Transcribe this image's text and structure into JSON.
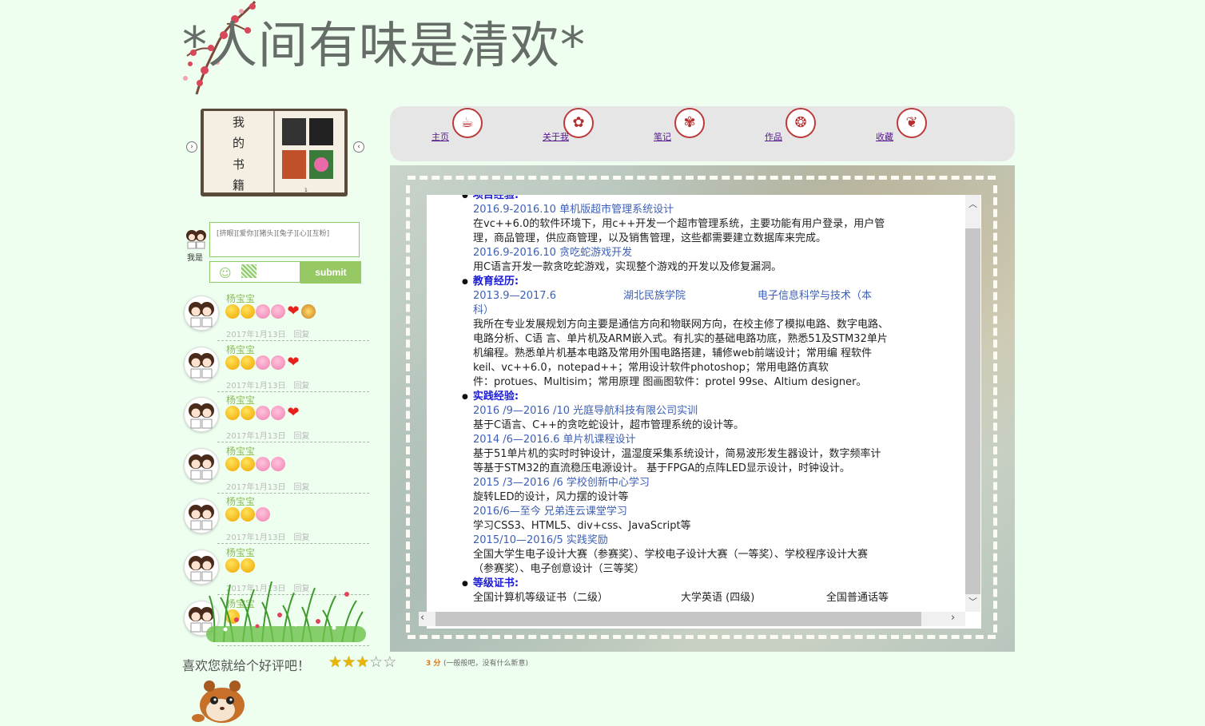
{
  "site": {
    "title": "*人间有味是清欢*"
  },
  "bookshelf": {
    "title_chars": [
      "我",
      "的",
      "书",
      "籍"
    ],
    "page_no": "1"
  },
  "comment_box": {
    "avatar_label": "我是",
    "placeholder": "[挤眼][爱你][猪头][兔子][心][互粉]",
    "submit_label": "submit"
  },
  "comments": [
    {
      "name": "杨宝宝",
      "date": "2017年1月13日",
      "reply": "回复",
      "emojis": [
        "face",
        "face",
        "pig",
        "pig",
        "heart",
        "mess"
      ]
    },
    {
      "name": "杨宝宝",
      "date": "2017年1月13日",
      "reply": "回复",
      "emojis": [
        "face",
        "face",
        "pig",
        "pig",
        "heart"
      ]
    },
    {
      "name": "杨宝宝",
      "date": "2017年1月13日",
      "reply": "回复",
      "emojis": [
        "face",
        "face",
        "pig",
        "pig",
        "heart"
      ]
    },
    {
      "name": "杨宝宝",
      "date": "2017年1月13日",
      "reply": "回复",
      "emojis": [
        "face",
        "face",
        "pig",
        "pig"
      ]
    },
    {
      "name": "杨宝宝",
      "date": "2017年1月13日",
      "reply": "回复",
      "emojis": [
        "face",
        "face",
        "pig"
      ]
    },
    {
      "name": "杨宝宝",
      "date": "2017年1月13日",
      "reply": "回复",
      "emojis": [
        "face",
        "face"
      ]
    },
    {
      "name": "杨宝宝",
      "date": "",
      "reply": "",
      "emojis": [
        "face"
      ]
    }
  ],
  "rating": {
    "label": "喜欢您就给个好评吧！",
    "value": 3,
    "max": 5,
    "score_text": "3 分",
    "description": "(一般般吧，没有什么新意)"
  },
  "nav": [
    {
      "label": "主页",
      "icon": "teacup-icon",
      "glyph": "☕"
    },
    {
      "label": "关于我",
      "icon": "fan-icon",
      "glyph": "✿"
    },
    {
      "label": "笔记",
      "icon": "fan-icon",
      "glyph": "✾"
    },
    {
      "label": "作品",
      "icon": "lantern-icon",
      "glyph": "❂"
    },
    {
      "label": "收藏",
      "icon": "maple-leaf-icon",
      "glyph": "❦"
    }
  ],
  "resume": {
    "projects_head": "项目经验:",
    "projects": [
      {
        "title": "2016.9-2016.10 单机版超市管理系统设计",
        "desc": [
          "在vc++6.0的软件环境下，用c++开发一个超市管理系统，主要功能有用户登录，用户管",
          "理，商品管理，供应商管理，以及销售管理，这些都需要建立数据库来完成。"
        ]
      },
      {
        "title": "2016.9-2016.10 贪吃蛇游戏开发",
        "desc": [
          "用C语言开发一款贪吃蛇游戏，实现整个游戏的开发以及修复漏洞。"
        ]
      }
    ],
    "education_head": "教育经历:",
    "education": {
      "period": "2013.9—2017.6",
      "school": "湖北民族学院",
      "major": "电子信息科学与技术（本",
      "major_cont": "科）",
      "desc": [
        "我所在专业发展规划方向主要是通信方向和物联网方向，在校主修了模拟电路、数字电路、",
        "电路分析、C语 言、单片机及ARM嵌入式。有扎实的基础电路功底，熟悉51及STM32单片",
        "机编程。熟悉单片机基本电路及常用外围电路搭建，辅修web前端设计；常用编 程软件",
        "keil、vc++6.0，notepad++；常用设计软件photoshop；常用电路仿真软",
        "件：protues、Multisim；常用原理 图画图软件：protel 99se、Altium designer。"
      ]
    },
    "practice_head": "实践经验:",
    "practice": [
      {
        "title": "2016 /9—2016 /10 光庭导航科技有限公司实训",
        "desc": [
          "基于C语言、C++的贪吃蛇设计，超市管理系统的设计等。"
        ]
      },
      {
        "title": "2014 /6—2016.6 单片机课程设计",
        "desc": [
          "基于51单片机的实时时钟设计，温湿度采集系统设计，简易波形发生器设计，数字频率计",
          "等基于STM32的直流稳压电源设计。 基于FPGA的点阵LED显示设计，时钟设计。"
        ]
      },
      {
        "title": "2015 /3—2016 /6 学校创新中心学习",
        "desc": [
          "旋转LED的设计，风力摆的设计等"
        ]
      },
      {
        "title": "2016/6—至今 兄弟连云课堂学习",
        "desc": [
          "学习CSS3、HTML5、div+css、JavaScript等"
        ]
      },
      {
        "title": "2015/10—2016/5 实践奖励",
        "desc": [
          "全国大学生电子设计大赛（参赛奖）、学校电子设计大赛（一等奖）、学校程序设计大赛",
          "（参赛奖）、电子创意设计（三等奖）"
        ]
      }
    ],
    "cert_head": "等级证书:",
    "certs": [
      "全国计算机等级证书（二级）",
      "大学英语 (四级)",
      "全国普通话等"
    ]
  },
  "colors": {
    "background": "#eefff0",
    "accent_green": "#96c864",
    "heading_blue": "#1b1bd6",
    "link_blue": "#3d5fb5"
  }
}
